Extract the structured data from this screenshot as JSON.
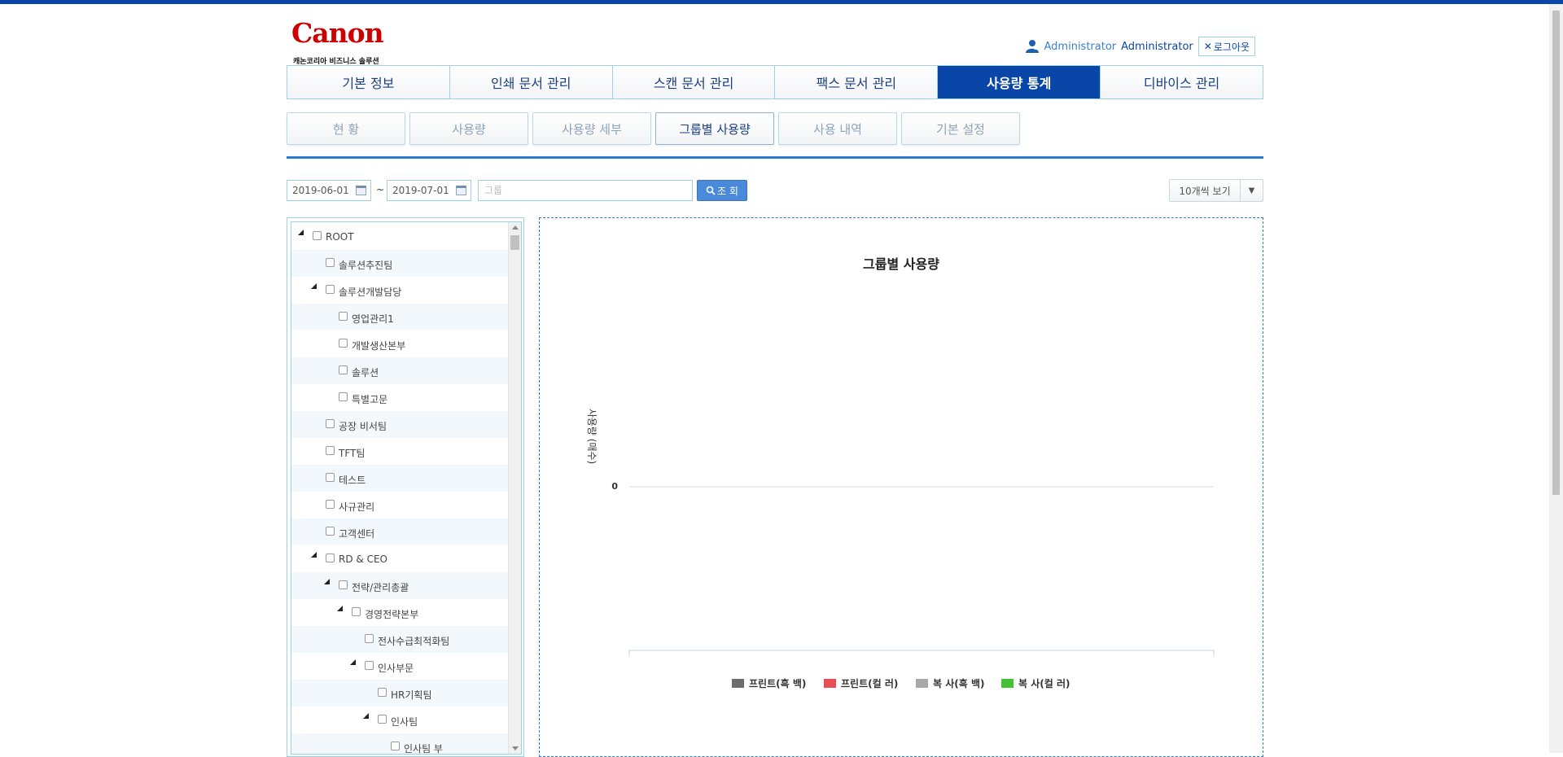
{
  "header": {
    "logo_text": "Canon",
    "logo_subtitle": "캐논코리아 비즈니스 솔루션",
    "user_role": "Administrator",
    "user_name": "Administrator",
    "logout_label": "로그아웃"
  },
  "main_nav": [
    {
      "label": "기본 정보",
      "active": false
    },
    {
      "label": "인쇄 문서 관리",
      "active": false
    },
    {
      "label": "스캔 문서 관리",
      "active": false
    },
    {
      "label": "팩스 문서 관리",
      "active": false
    },
    {
      "label": "사용량 통계",
      "active": true
    },
    {
      "label": "디바이스 관리",
      "active": false
    }
  ],
  "sub_nav": [
    {
      "label": "현 황",
      "active": false
    },
    {
      "label": "사용량",
      "active": false
    },
    {
      "label": "사용량 세부",
      "active": false
    },
    {
      "label": "그룹별 사용량",
      "active": true
    },
    {
      "label": "사용 내역",
      "active": false
    },
    {
      "label": "기본 설정",
      "active": false
    }
  ],
  "filters": {
    "start_date": "2019-06-01",
    "separator": "~",
    "end_date": "2019-07-01",
    "group_placeholder": "그룹",
    "search_label": "조 회",
    "per_page_label": "10개씩 보기"
  },
  "tree": [
    {
      "label": "ROOT",
      "depth": 0,
      "expanded": true
    },
    {
      "label": "솔루션추진팀",
      "depth": 1,
      "expanded": false
    },
    {
      "label": "솔루션개발담당",
      "depth": 1,
      "expanded": true
    },
    {
      "label": "영업관리1",
      "depth": 2,
      "expanded": false
    },
    {
      "label": "개발생산본부",
      "depth": 2,
      "expanded": false
    },
    {
      "label": "솔루션",
      "depth": 2,
      "expanded": false
    },
    {
      "label": "특별고문",
      "depth": 2,
      "expanded": false
    },
    {
      "label": "공장 비서팀",
      "depth": 1,
      "expanded": false
    },
    {
      "label": "TFT팀",
      "depth": 1,
      "expanded": false
    },
    {
      "label": "테스트",
      "depth": 1,
      "expanded": false
    },
    {
      "label": "사규관리",
      "depth": 1,
      "expanded": false
    },
    {
      "label": "고객센터",
      "depth": 1,
      "expanded": false
    },
    {
      "label": "RD & CEO",
      "depth": 1,
      "expanded": true
    },
    {
      "label": "전략/관리총괄",
      "depth": 2,
      "expanded": true
    },
    {
      "label": "경영전략본부",
      "depth": 3,
      "expanded": true
    },
    {
      "label": "전사수급최적화팀",
      "depth": 4,
      "expanded": false
    },
    {
      "label": "인사부문",
      "depth": 4,
      "expanded": true
    },
    {
      "label": "HR기획팀",
      "depth": 5,
      "expanded": false
    },
    {
      "label": "인사팀",
      "depth": 5,
      "expanded": true
    },
    {
      "label": "인사팀 부",
      "depth": 6,
      "expanded": false
    }
  ],
  "chart_data": {
    "type": "bar",
    "title": "그룹별 사용량",
    "ylabel": "사용량 (매수)",
    "xlabel": "",
    "categories": [],
    "y_ticks": [
      "0"
    ],
    "series": [
      {
        "name": "프린트(흑 백)",
        "color": "#6d6d6d",
        "values": []
      },
      {
        "name": "프린트(컬 러)",
        "color": "#e84c55",
        "values": []
      },
      {
        "name": "복 사(흑 백)",
        "color": "#a9a9a9",
        "values": []
      },
      {
        "name": "복 사(컬 러)",
        "color": "#46c034",
        "values": []
      }
    ],
    "legend_position": "bottom",
    "grid": true
  }
}
